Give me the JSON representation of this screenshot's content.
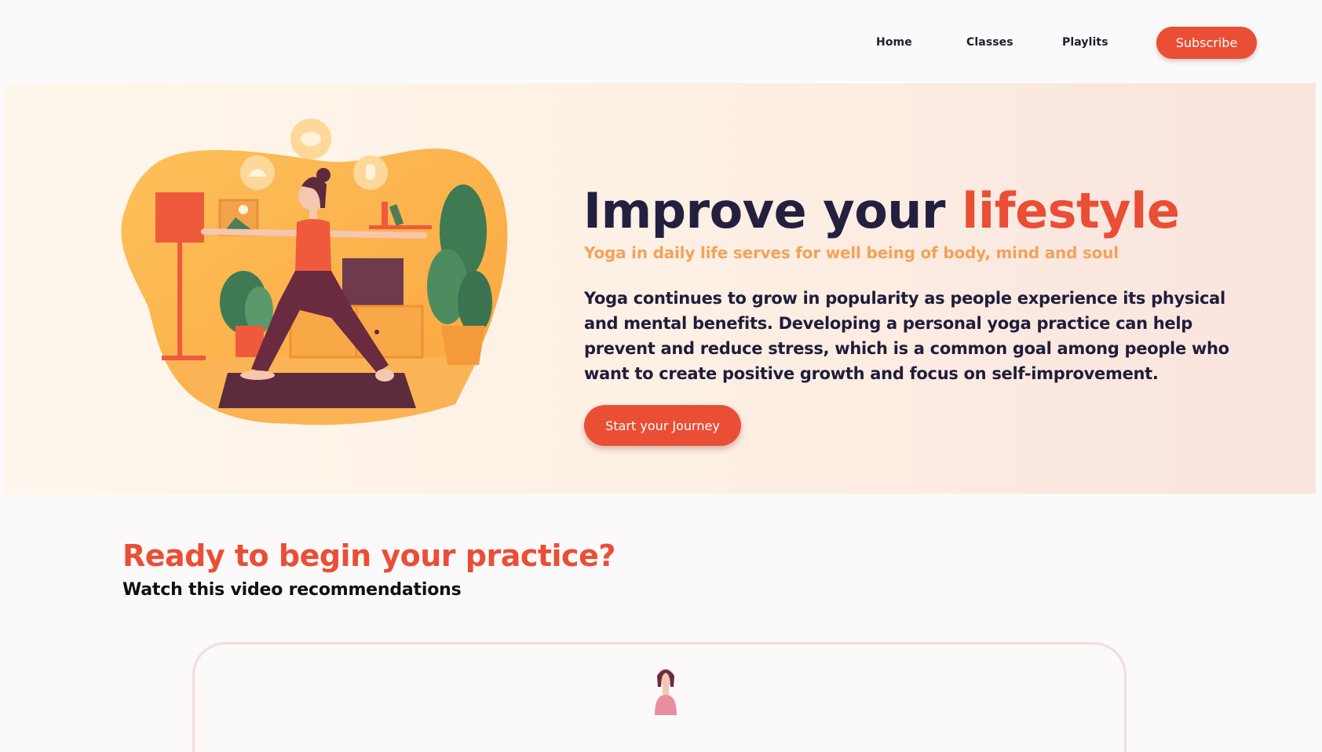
{
  "nav": {
    "items": [
      {
        "label": "Home"
      },
      {
        "label": "Classes"
      },
      {
        "label": "Playlits"
      }
    ],
    "subscribe_label": "Subscribe"
  },
  "hero": {
    "title_main": "Improve your ",
    "title_accent": "lifestyle",
    "subtitle": "Yoga in daily life serves for well being of body, mind and soul",
    "body": "Yoga continues to grow in popularity as people experience its physical and mental benefits. Developing a personal yoga practice can help prevent and reduce stress, which is a common goal among people who want to create positive growth and focus on self-improvement.",
    "cta_label": "Start your Journey"
  },
  "section": {
    "title": "Ready to begin your practice?",
    "subtitle": "Watch this video recommendations"
  },
  "colors": {
    "accent": "#ea4e35",
    "navy": "#231f3f",
    "subtitle": "#f3a25a",
    "hero_bg_start": "#fff7ed",
    "hero_bg_end": "#f9e4de"
  }
}
